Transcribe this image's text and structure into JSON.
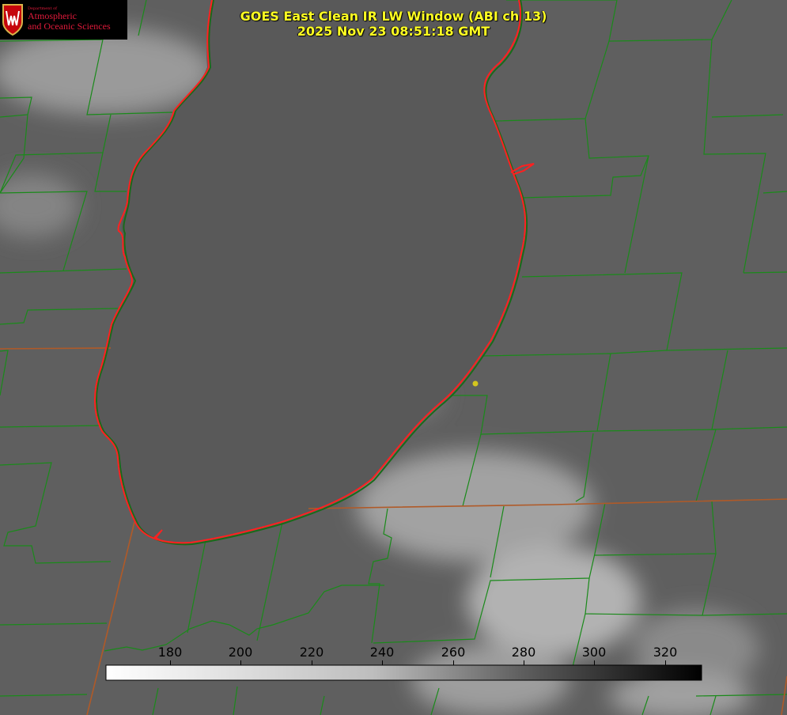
{
  "title": {
    "line1": "GOES East Clean IR LW Window (ABI ch 13)",
    "line2": "2025 Nov 23 08:51:18 GMT"
  },
  "logo": {
    "department": "Department of",
    "line1": "Atmospheric",
    "line2": "and Oceanic Sciences"
  },
  "colorbar": {
    "ticks": [
      "180",
      "200",
      "220",
      "240",
      "260",
      "280",
      "300",
      "320"
    ],
    "gradient_start": "#ffffff",
    "gradient_end": "#000000"
  },
  "colors": {
    "county_lines": "#1a8a1a",
    "state_lines": "#a0522d",
    "shoreline": "#ff2020",
    "marker": "#d4c61e",
    "title_text": "#ffff22"
  }
}
